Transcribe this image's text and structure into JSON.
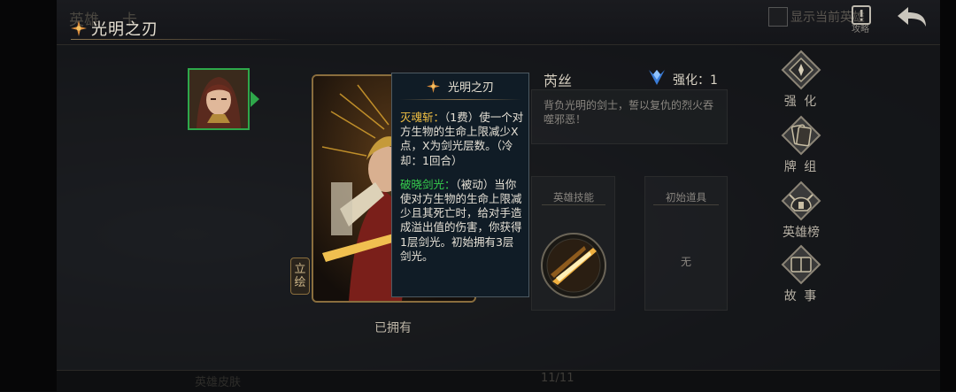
{
  "topbar": {
    "ghost_tab_1": "英雄",
    "ghost_tab_2": "卡",
    "title": "光明之刃",
    "show_current_label": "显示当前英雄",
    "guide_label": "攻略"
  },
  "avatar": {
    "icon": "hero-portrait"
  },
  "card": {
    "side_tab": [
      "立",
      "绘"
    ],
    "owned_label": "已拥有"
  },
  "tooltip": {
    "title": "光明之刃",
    "skill1_name": "灭魂斩：",
    "skill1_text": "（1费）使一个对方生物的生命上限减少X点，X为剑光层数。（冷却：1回合）",
    "skill2_name": "破晓剑光：",
    "skill2_text": "（被动）当你使对方生物的生命上限减少且其死亡时，给对手造成溢出值的伤害，你获得1层剑光。初始拥有3层剑光。"
  },
  "hero": {
    "name": "芮丝",
    "enhance_label": "强化：1",
    "description": "背负光明的剑士，誓以复仇的烈火吞噬邪恶！",
    "skill_header": "英雄技能",
    "item_header": "初始道具",
    "item_none": "无"
  },
  "menu": {
    "enhance": "强 化",
    "deck": "牌 组",
    "ranking": "英雄榜",
    "story": "故 事"
  },
  "bottom": {
    "ghost_label": "英雄皮肤",
    "page": "11/11"
  },
  "colors": {
    "accent_gold": "#8a6e3e",
    "skill1": "#f2c144",
    "skill2": "#36d04e",
    "select_green": "#2ea84a"
  }
}
